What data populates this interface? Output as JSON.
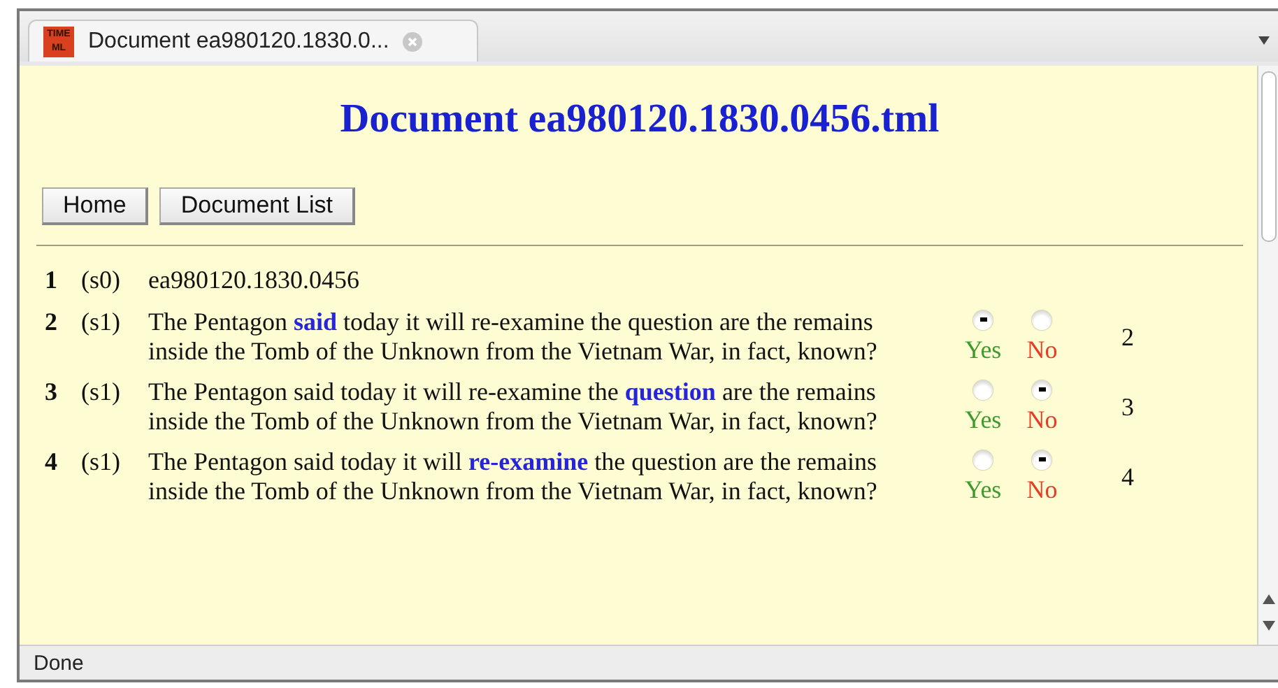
{
  "tab": {
    "title": "Document ea980120.1830.0...",
    "logo": "TIME ML"
  },
  "heading": "Document ea980120.1830.0456.tml",
  "buttons": [
    "Home",
    "Document List"
  ],
  "rows": [
    {
      "number": "1",
      "sentence": "(s0)",
      "text": "ea980120.1830.0456"
    },
    {
      "number": "2",
      "sentence": "(s1)",
      "text": "The Pentagon **said** today it will re-examine the question are the remains inside the Tomb of the Unknown from the Vietnam War, in fact, known?",
      "choices": [
        {
          "label": "Yes",
          "selected": true
        },
        {
          "label": "No",
          "selected": false
        }
      ],
      "count": "2"
    },
    {
      "number": "3",
      "sentence": "(s1)",
      "text": "The Pentagon said today it will re-examine the **question** are the remains inside the Tomb of the Unknown from the Vietnam War, in fact, known?",
      "choices": [
        {
          "label": "Yes",
          "selected": false
        },
        {
          "label": "No",
          "selected": true
        }
      ],
      "count": "3"
    },
    {
      "number": "4",
      "sentence": "(s1)",
      "text": "The Pentagon said today it will **re-examine** the question are the remains inside the Tomb of the Unknown from the Vietnam War, in fact, known?",
      "choices": [
        {
          "label": "Yes",
          "selected": false
        },
        {
          "label": "No",
          "selected": true
        }
      ],
      "count": "4"
    }
  ],
  "status_bar": "Done"
}
